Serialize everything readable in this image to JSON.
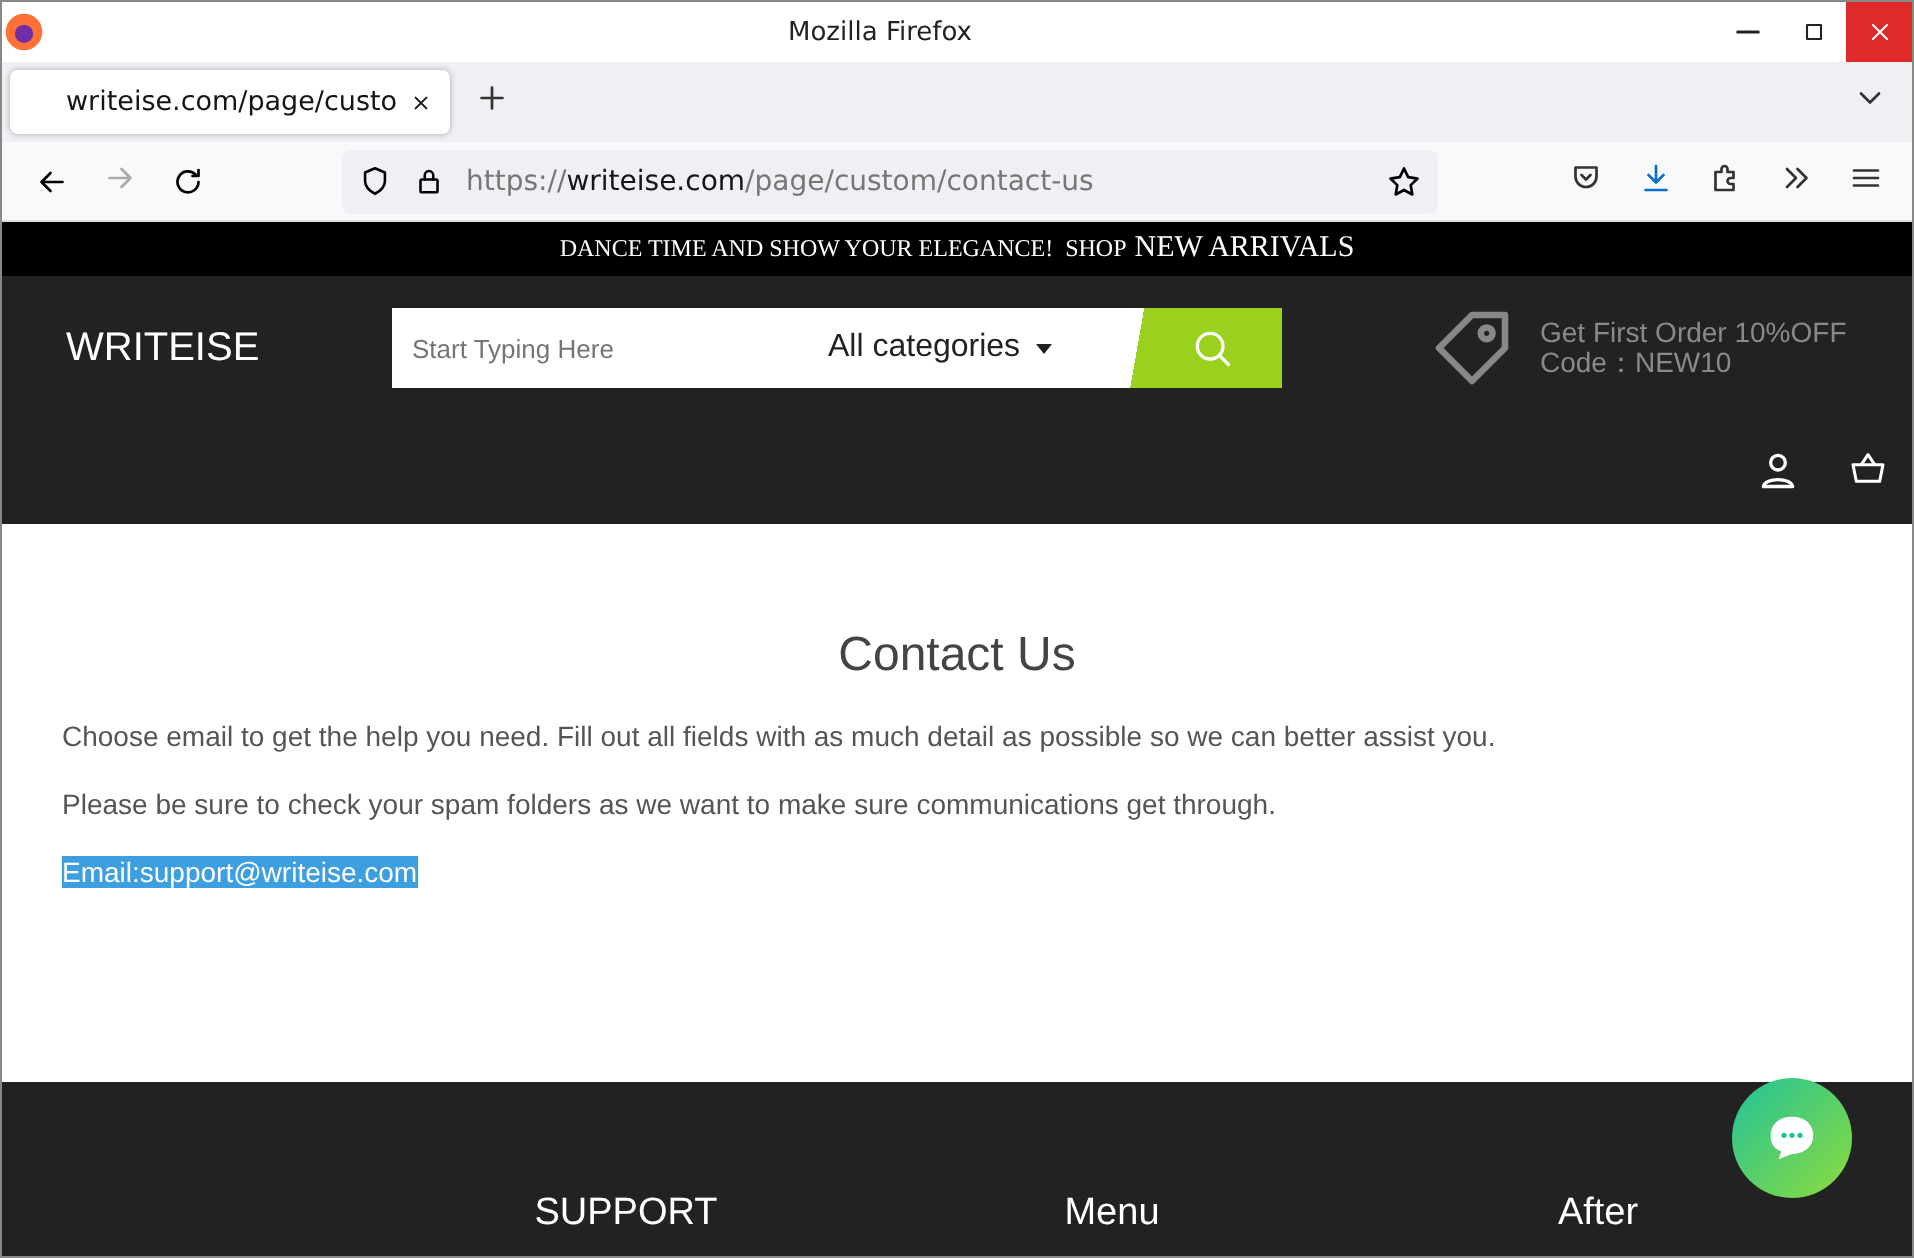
{
  "window": {
    "title": "Mozilla Firefox"
  },
  "tabs": [
    {
      "label": "writeise.com/page/custo",
      "selected": true
    }
  ],
  "url": {
    "scheme": "https://",
    "host": "writeise.com",
    "path": "/page/custom/contact-us"
  },
  "announcement": {
    "lead": "DANCE TIME AND SHOW YOUR ELEGANCE!  SHOP",
    "highlight": "NEW ARRIVALS"
  },
  "header": {
    "logo": "WRITEISE",
    "search": {
      "placeholder": "Start Typing Here",
      "category": "All categories"
    },
    "promo": [
      "Get First Order 10%OFF",
      "Code：NEW10"
    ]
  },
  "content": {
    "title": "Contact Us",
    "paragraphs": [
      "Choose email to get the help you need. Fill out all fields with as much detail as possible so we can better assist you.",
      "Please be sure to check your spam folders as we want to make sure communications get through."
    ],
    "email": {
      "text": "Email:support@writeise.com",
      "selected": true
    }
  },
  "footer": {
    "columns": [
      "SUPPORT",
      "Menu",
      "After"
    ]
  }
}
